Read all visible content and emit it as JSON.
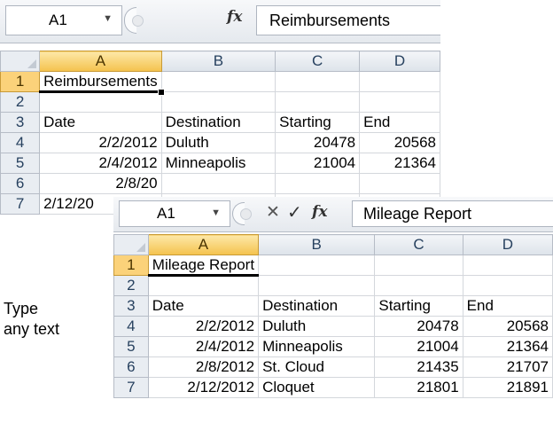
{
  "callout": {
    "line1": "Type",
    "line2": "any text"
  },
  "back": {
    "name_box": "A1",
    "fx": "fx",
    "formula": "Reimbursements",
    "columns": [
      "A",
      "B",
      "C",
      "D"
    ],
    "rows": [
      {
        "num": "1",
        "a": "Reimbursements",
        "b": "",
        "c": "",
        "d": ""
      },
      {
        "num": "2",
        "a": "",
        "b": "",
        "c": "",
        "d": ""
      },
      {
        "num": "3",
        "a": "Date",
        "b": "Destination",
        "c": "Starting",
        "d": "End"
      },
      {
        "num": "4",
        "a": "2/2/2012",
        "b": "Duluth",
        "c": "20478",
        "d": "20568"
      },
      {
        "num": "5",
        "a": "2/4/2012",
        "b": "Minneapolis",
        "c": "21004",
        "d": "21364"
      },
      {
        "num": "6",
        "a": "2/8/20",
        "b": "",
        "c": "",
        "d": ""
      },
      {
        "num": "7",
        "a": "2/12/20",
        "b": "",
        "c": "",
        "d": ""
      }
    ]
  },
  "front": {
    "name_box": "A1",
    "cancel": "✕",
    "enter": "✓",
    "fx": "fx",
    "formula": "Mileage Report",
    "columns": [
      "A",
      "B",
      "C",
      "D"
    ],
    "rows": [
      {
        "num": "1",
        "a": "Mileage Report",
        "b": "",
        "c": "",
        "d": ""
      },
      {
        "num": "2",
        "a": "",
        "b": "",
        "c": "",
        "d": ""
      },
      {
        "num": "3",
        "a": "Date",
        "b": "Destination",
        "c": "Starting",
        "d": "End"
      },
      {
        "num": "4",
        "a": "2/2/2012",
        "b": "Duluth",
        "c": "20478",
        "d": "20568"
      },
      {
        "num": "5",
        "a": "2/4/2012",
        "b": "Minneapolis",
        "c": "21004",
        "d": "21364"
      },
      {
        "num": "6",
        "a": "2/8/2012",
        "b": "St. Cloud",
        "c": "21435",
        "d": "21707"
      },
      {
        "num": "7",
        "a": "2/12/2012",
        "b": "Cloquet",
        "c": "21801",
        "d": "21891"
      }
    ]
  }
}
